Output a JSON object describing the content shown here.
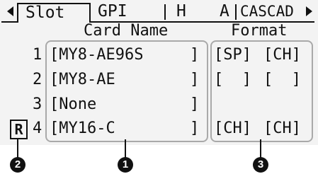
{
  "tabs": [
    {
      "label": "Slot",
      "active": true
    },
    {
      "label": "GPI"
    },
    {
      "label": "H"
    },
    {
      "label": "A"
    },
    {
      "label": "CASCAD"
    }
  ],
  "headers": {
    "card_name": "Card Name",
    "format": "Format"
  },
  "rows": [
    {
      "num": "1",
      "card": "[MY8-AE96S",
      "close": "]",
      "fmt1": "[SP]",
      "fmt2": "[CH]"
    },
    {
      "num": "2",
      "card": "[MY8-AE",
      "close": "]",
      "fmt1": "[  ]",
      "fmt2": "[  ]"
    },
    {
      "num": "3",
      "card": "[None",
      "close": "]",
      "fmt1": "",
      "fmt2": ""
    },
    {
      "num": "4",
      "card": "[MY16-C",
      "close": "]",
      "fmt1": "[CH]",
      "fmt2": "[CH]"
    }
  ],
  "row4_marker": "R",
  "callouts": [
    "1",
    "2",
    "3"
  ],
  "colors": {
    "lcd_bg": "#f3f3f3",
    "ink": "#111111",
    "group_border": "#a9a9a9"
  },
  "icons": {
    "scroll_left": "left-triangle-icon",
    "scroll_right": "right-triangle-icon"
  }
}
